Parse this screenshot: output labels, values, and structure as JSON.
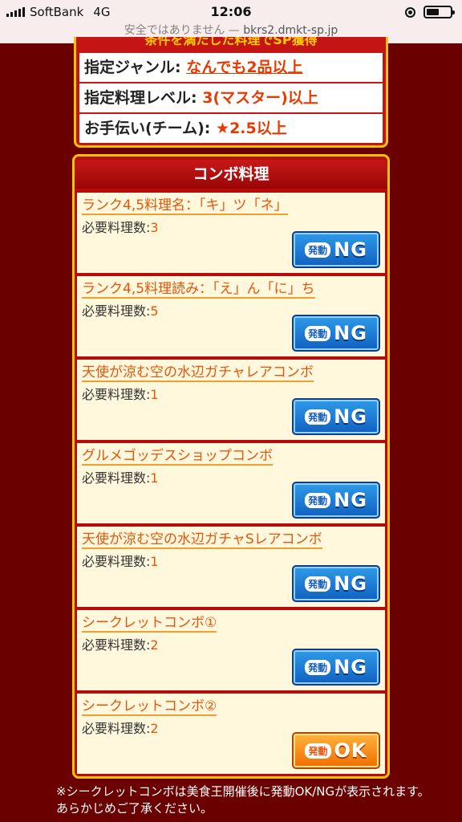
{
  "status_bar": {
    "carrier": "SoftBank",
    "network": "4G",
    "time": "12:06",
    "battery_level": 0.55
  },
  "url_bar": {
    "security": "安全ではありません —",
    "host": "bkrs2.dmkt-sp.jp"
  },
  "conditions": {
    "header_partial": "条件を満たした料理でSP獲得",
    "rows": [
      {
        "label": "指定ジャンル:",
        "value": "なんでも2品以上"
      },
      {
        "label": "指定料理レベル:",
        "value": "3(マスター)以上"
      },
      {
        "label": "お手伝い(チーム):",
        "value": "★2.5以上"
      }
    ]
  },
  "combo": {
    "title": "コンボ料理",
    "req_label": "必要料理数:",
    "btn_small": "発動",
    "items": [
      {
        "name": "ランク4,5料理名：「キ」ツ「ネ」",
        "count": "3",
        "status": "NG"
      },
      {
        "name": "ランク4,5料理読み：「え」ん「に」ち",
        "count": "5",
        "status": "NG"
      },
      {
        "name": "天使が涼む空の水辺ガチャレアコンボ",
        "count": "1",
        "status": "NG"
      },
      {
        "name": "グルメゴッデスショップコンボ",
        "count": "1",
        "status": "NG"
      },
      {
        "name": "天使が涼む空の水辺ガチャSレアコンボ",
        "count": "1",
        "status": "NG"
      },
      {
        "name": "シークレットコンボ①",
        "count": "2",
        "status": "NG"
      },
      {
        "name": "シークレットコンボ②",
        "count": "2",
        "status": "OK"
      }
    ]
  },
  "note": "※シークレットコンボは美食王開催後に発動OK/NGが表示されます。あらかじめご了承ください。",
  "colors": {
    "page_bg": "#6b0000",
    "panel_red": "#b70c0c",
    "gold_border": "#f4c400",
    "orange_text": "#e8540a",
    "ng_blue": "#1660b8",
    "ok_orange": "#f06d00"
  }
}
